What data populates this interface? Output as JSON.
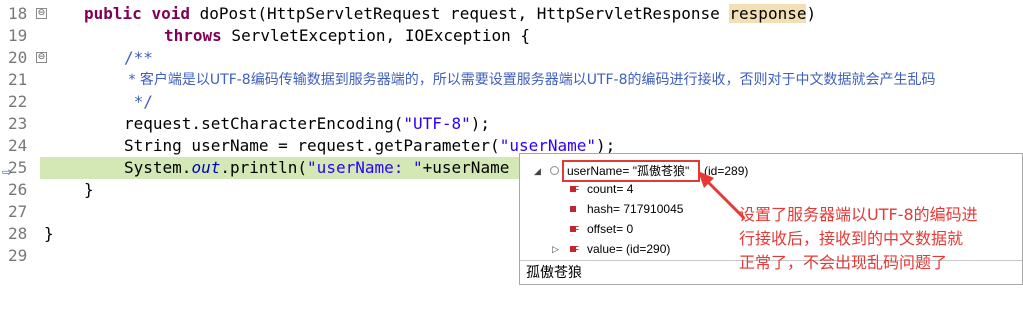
{
  "editor": {
    "lines": [
      {
        "num": "18",
        "fold": "⊖"
      },
      {
        "num": "19"
      },
      {
        "num": "20",
        "fold": "⊖"
      },
      {
        "num": "21"
      },
      {
        "num": "22"
      },
      {
        "num": "23"
      },
      {
        "num": "24"
      },
      {
        "num": "25"
      },
      {
        "num": "26"
      },
      {
        "num": "27"
      },
      {
        "num": "28"
      },
      {
        "num": "29"
      }
    ],
    "l18": {
      "kw1": "public",
      "kw2": "void",
      "a": " doPost(HttpServletRequest request, HttpServletResponse ",
      "hl": "response",
      "b": ")"
    },
    "l19": {
      "kw": "throws",
      "rest": " ServletException, IOException {"
    },
    "l20": {
      "text": "/**"
    },
    "l21": {
      "text": " * 客户端是以UTF-8编码传输数据到服务器端的，所以需要设置服务器端以UTF-8的编码进行接收，否则对于中文数据就会产生乱码"
    },
    "l22": {
      "text": " */"
    },
    "l23": {
      "a": "request.setCharacterEncoding(",
      "s": "\"UTF-8\"",
      "b": ");"
    },
    "l24": {
      "a": "String userName = request.getParameter(",
      "s": "\"userName\"",
      "b": ");"
    },
    "l25": {
      "a": "System.",
      "it": "out",
      "b": ".println(",
      "s": "\"userName: \"",
      "c": "+userName"
    },
    "l26": {
      "text": "}"
    },
    "l28": {
      "text": "}"
    }
  },
  "popup": {
    "root": {
      "label": "userName= \"孤傲苍狼\"",
      "id": "(id=289)"
    },
    "fields": [
      {
        "label": "count= 4"
      },
      {
        "label": "hash= 717910045"
      },
      {
        "label": "offset= 0"
      },
      {
        "label": "value=  (id=290)"
      }
    ],
    "detail": "孤傲苍狼"
  },
  "annotation": {
    "lines": [
      "设置了服务器端以UTF-8的编码进",
      "行接收后，接收到的中文数据就",
      "正常了，不会出现乱码问题了"
    ],
    "color": "#e53935"
  }
}
